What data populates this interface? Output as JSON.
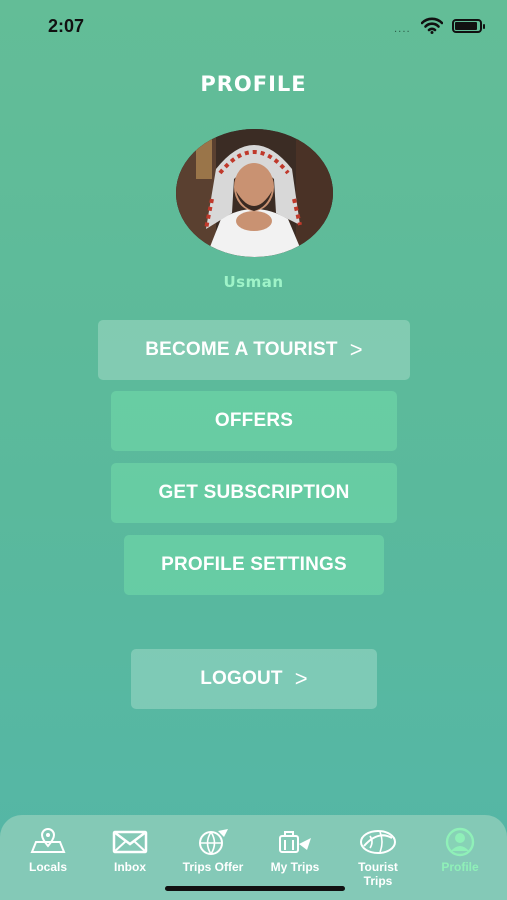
{
  "status_bar": {
    "time": "2:07",
    "signal": "....",
    "wifi": "wifi-icon",
    "battery": "battery-icon"
  },
  "header": {
    "title": "PROFILE"
  },
  "profile": {
    "name": "Usman",
    "avatar": "profile-photo"
  },
  "menu": {
    "become_tourist": "BECOME A TOURIST",
    "offers": "OFFERS",
    "subscription": "GET SUBSCRIPTION",
    "settings": "PROFILE SETTINGS",
    "logout": "LOGOUT",
    "chevron": ">"
  },
  "tabs": [
    {
      "label": "Locals",
      "icon": "map-pin-icon"
    },
    {
      "label": "Inbox",
      "icon": "mail-icon"
    },
    {
      "label": "Trips Offer",
      "icon": "globe-plane-icon"
    },
    {
      "label": "My Trips",
      "icon": "luggage-icon"
    },
    {
      "label": "Tourist\nTrips",
      "icon": "globe-leaf-icon"
    },
    {
      "label": "Profile",
      "icon": "user-icon",
      "active": true
    }
  ],
  "colors": {
    "accent_green": "#9ff3c8",
    "active_tab": "#8ff0b8",
    "background_top": "#63bd97",
    "background_bottom": "#54b6a7"
  }
}
